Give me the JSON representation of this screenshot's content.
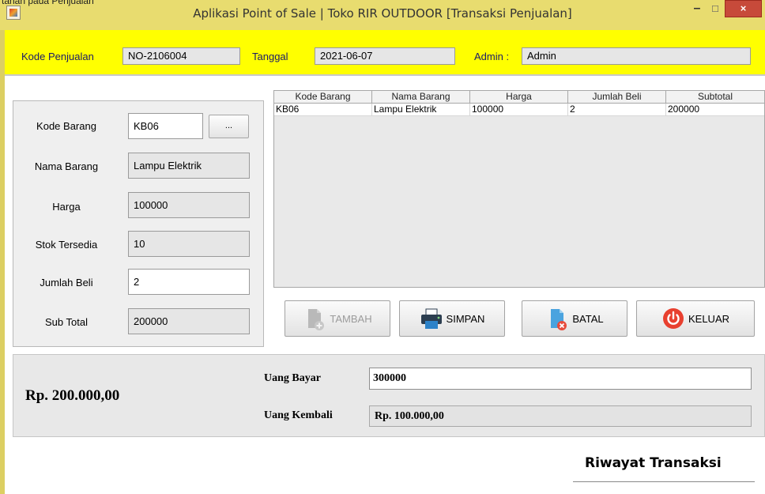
{
  "window": {
    "caption_top": "tahan pada Penjualan",
    "title": "Aplikasi Point of Sale | Toko RIR OUTDOOR [Transaksi Penjualan]",
    "controls": {
      "minimize": "–",
      "maximize": "☐",
      "close": "×"
    }
  },
  "header": {
    "kode_penjualan_label": "Kode Penjualan",
    "kode_penjualan_value": "NO-2106004",
    "tanggal_label": "Tanggal",
    "tanggal_value": "2021-06-07",
    "admin_label": "Admin :",
    "admin_value": "Admin",
    "background_color": "#ffff00"
  },
  "form": {
    "kode_barang_label": "Kode Barang",
    "kode_barang_value": "KB06",
    "browse_label": "...",
    "nama_barang_label": "Nama Barang",
    "nama_barang_value": "Lampu Elektrik",
    "harga_label": "Harga",
    "harga_value": "100000",
    "stok_label": "Stok Tersedia",
    "stok_value": "10",
    "jumlah_label": "Jumlah Beli",
    "jumlah_value": "2",
    "subtotal_label": "Sub Total",
    "subtotal_value": "200000"
  },
  "table": {
    "columns": [
      "Kode Barang",
      "Nama Barang",
      "Harga",
      "Jumlah Beli",
      "Subtotal"
    ],
    "rows": [
      [
        "KB06",
        "Lampu Elektrik",
        "100000",
        "2",
        "200000"
      ]
    ]
  },
  "actions": {
    "tambah": "TAMBAH",
    "simpan": "SIMPAN",
    "batal": "BATAL",
    "keluar": "KELUAR"
  },
  "payment": {
    "total": "Rp. 200.000,00",
    "uang_bayar_label": "Uang Bayar",
    "uang_bayar_value": "300000",
    "uang_kembali_label": "Uang Kembali",
    "uang_kembali_value": "Rp. 100.000,00"
  },
  "history": {
    "title": "Riwayat Transaksi"
  }
}
